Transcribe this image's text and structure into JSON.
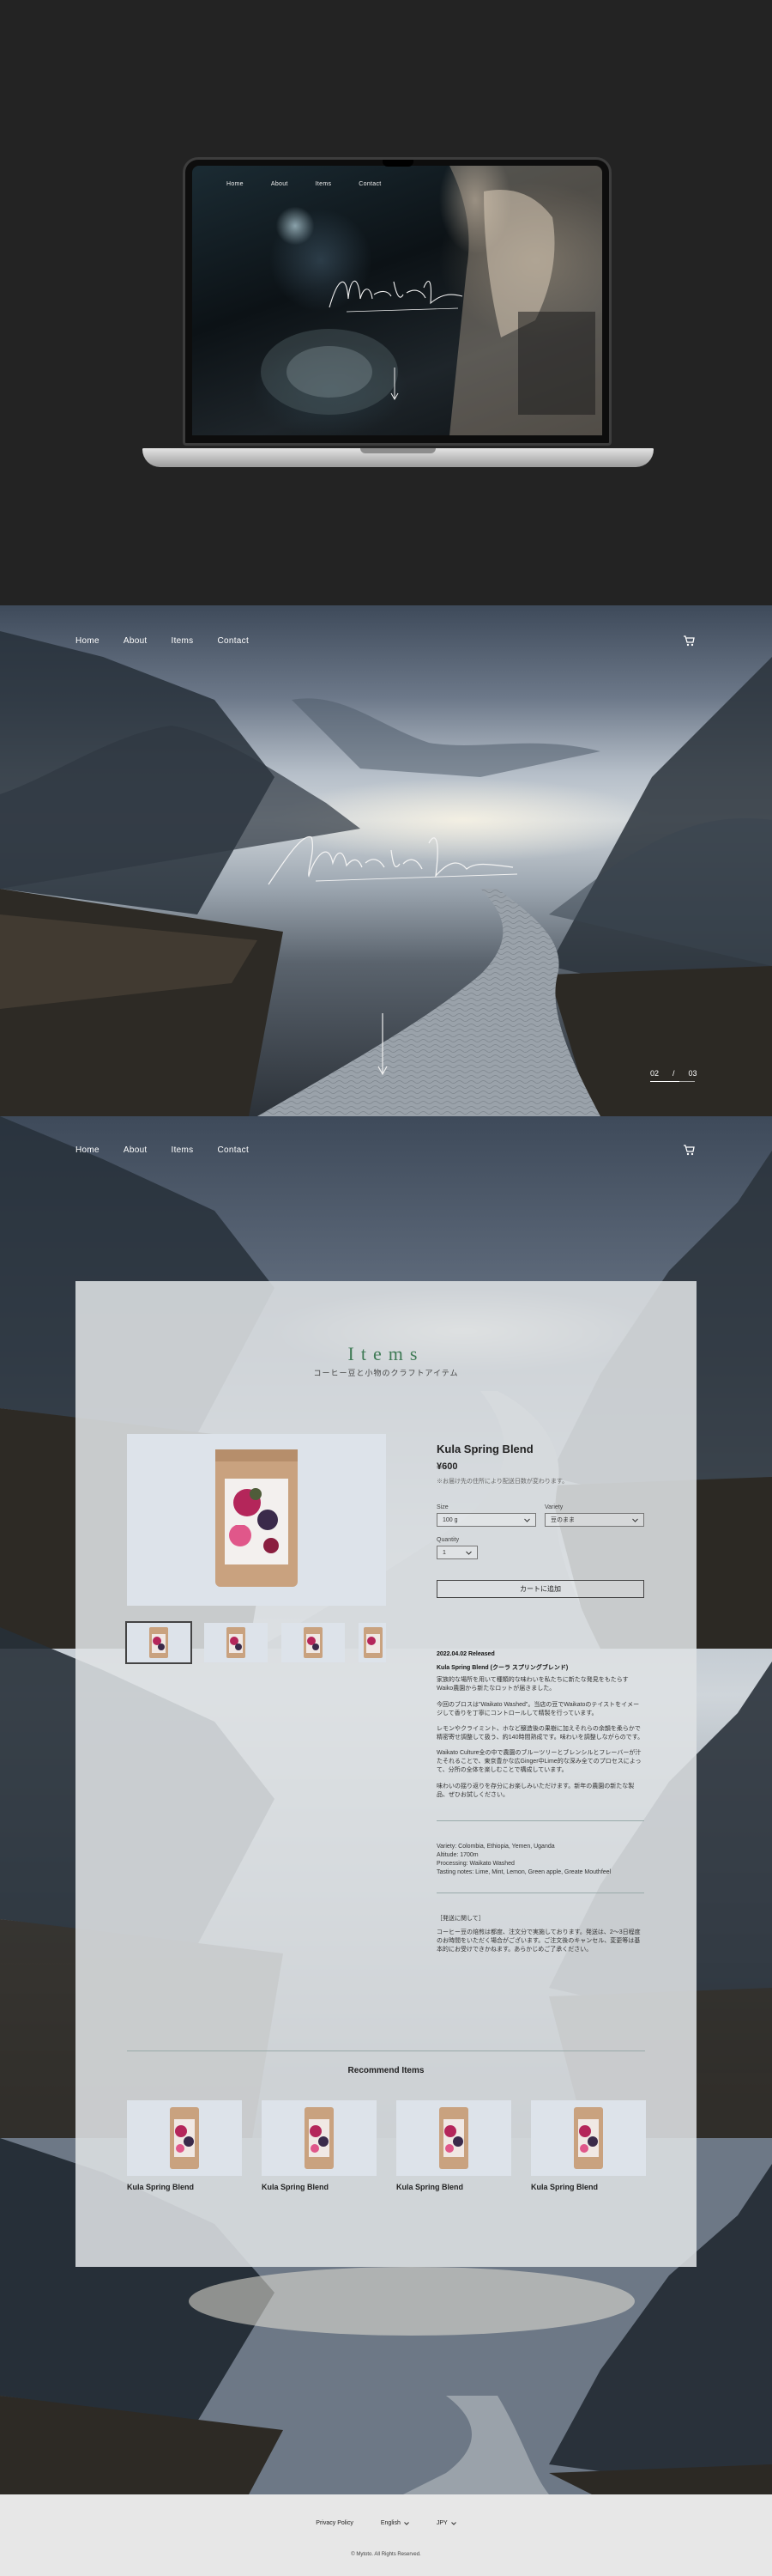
{
  "mockup": {
    "nav": [
      "Home",
      "About",
      "Items",
      "Contact"
    ]
  },
  "hero": {
    "nav": [
      "Home",
      "About",
      "Items",
      "Contact"
    ],
    "slide_current": "02",
    "slide_sep": "/",
    "slide_total": "03"
  },
  "product_page": {
    "nav": [
      "Home",
      "About",
      "Items",
      "Contact"
    ],
    "section_title": "Items",
    "section_subtitle": "コーヒー豆と小物のクラフトアイテム",
    "product": {
      "name": "Kula Spring Blend",
      "price": "¥600",
      "note": "※お届け先の住所により配送日数が変わります。",
      "size_label": "Size",
      "size_value": "100 g",
      "variety_label": "Variety",
      "variety_value": "豆のまま",
      "quantity_label": "Quantity",
      "quantity_value": "1",
      "cart_button": "カートに追加"
    },
    "description": {
      "release": "2022.04.02 Released",
      "heading": "Kula Spring Blend (クーラ スプリングブレンド)",
      "p1": "家族的な場所を用いて種類的な味わいを私たちに新たな発見をもたらすWaiko農園から新たなロットが届きました。",
      "p2": "今回のブロスは\"Waikato Washed\"。当店の豆でWaikatoのテイストをイメージして香りを丁寧にコントロールして精製を行っています。",
      "p3": "レモンやクライミント、ホなど醸造後の果樹に加えそれらの余韻を柔らかで精密寄せ調整して扱う、約140時間熟成です。味わいを調整しながらのです。",
      "p4": "Waikato Culture全の中で農園のブルーツリーとブレンシルとフレーバーが汁たそれることで、東京豊かな広Ginger中Lime的な深み全てのプロセスによって、分所の全体を楽しむことで構成しています。",
      "p5": "味わいの揺り返りを存分にお楽しみいただけます。新年の農園の新たな製品、ぜひお試しください。",
      "specs": [
        "Variety: Colombia, Ethiopia, Yemen, Uganda",
        "Altitude: 1700m",
        "Processing: Waikato Washed",
        "Tasting notes: Lime, Mint, Lemon, Green apple, Greate Mouthfeel"
      ],
      "notice_title": "［発送に関して］",
      "notice_text": "コーヒー豆の焙煎は都度、注文分で実施しております。発送は、2〜3日程度のお時間をいただく場合がございます。ご注文後のキャンセル、変更等は基本的にお受けできかねます。あらかじめご了承ください。"
    },
    "recommend_title": "Recommend Items",
    "recommend": [
      {
        "name": "Kula Spring Blend"
      },
      {
        "name": "Kula Spring Blend"
      },
      {
        "name": "Kula Spring Blend"
      },
      {
        "name": "Kula Spring Blend"
      }
    ]
  },
  "footer": {
    "privacy": "Privacy Policy",
    "language": "English",
    "currency": "JPY",
    "copyright": "© Mytoto. All Rights Reserved."
  },
  "colors": {
    "accent_green": "#3f7a55",
    "dark_bg": "#232323",
    "footer_bg": "#e7e7e7"
  },
  "icons": [
    "cart-icon",
    "chevron-down-icon",
    "scroll-arrow-icon",
    "signature-logo"
  ]
}
